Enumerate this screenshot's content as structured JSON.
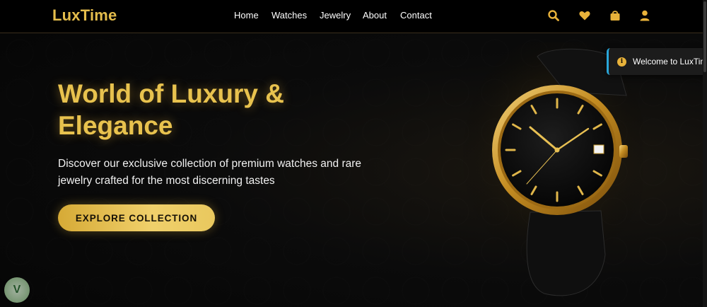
{
  "header": {
    "logo": "LuxTime",
    "nav": [
      "Home",
      "Watches",
      "Jewelry",
      "About",
      "Contact"
    ],
    "icons": [
      "search-icon",
      "heart-icon",
      "shopping-bag-icon",
      "user-icon"
    ]
  },
  "hero": {
    "title": "World of Luxury & Elegance",
    "subtitle": "Discover our exclusive collection of premium watches and rare jewelry crafted for the most discerning tastes",
    "cta_label": "EXPLORE COLLECTION"
  },
  "toast": {
    "icon": "info-icon",
    "text": "Welcome to LuxTime"
  },
  "colors": {
    "accent": "#E8C24E",
    "background": "#060606",
    "toast_border": "#29A6D9"
  }
}
